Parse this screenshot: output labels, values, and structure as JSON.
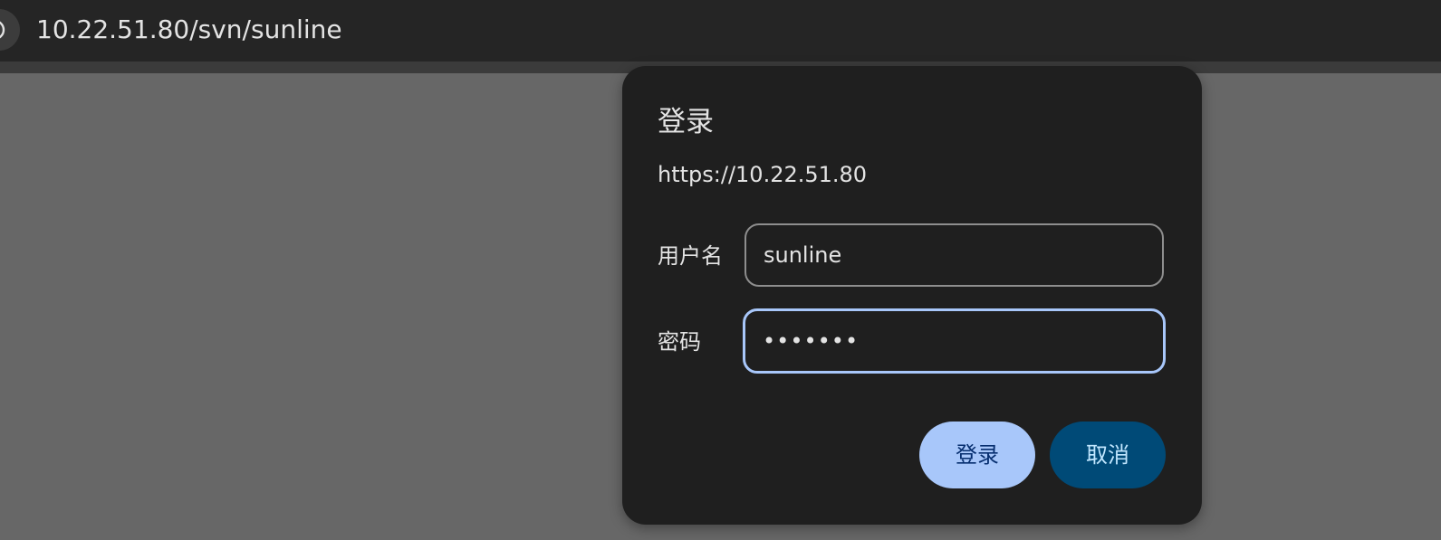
{
  "browser": {
    "url": "10.22.51.80/svn/sunline",
    "site_info_icon": "info-icon"
  },
  "dialog": {
    "title": "登录",
    "origin": "https://10.22.51.80",
    "username_label": "用户名",
    "username_value": "sunline",
    "password_label": "密码",
    "password_value": "•••••••",
    "login_button": "登录",
    "cancel_button": "取消"
  },
  "colors": {
    "page_background": "#676767",
    "toolbar": "#252525",
    "dialog_background": "#1f1f1f",
    "focus_ring": "#a8c7fa",
    "primary_button": "#a8c7fa",
    "secondary_button": "#004a77"
  }
}
